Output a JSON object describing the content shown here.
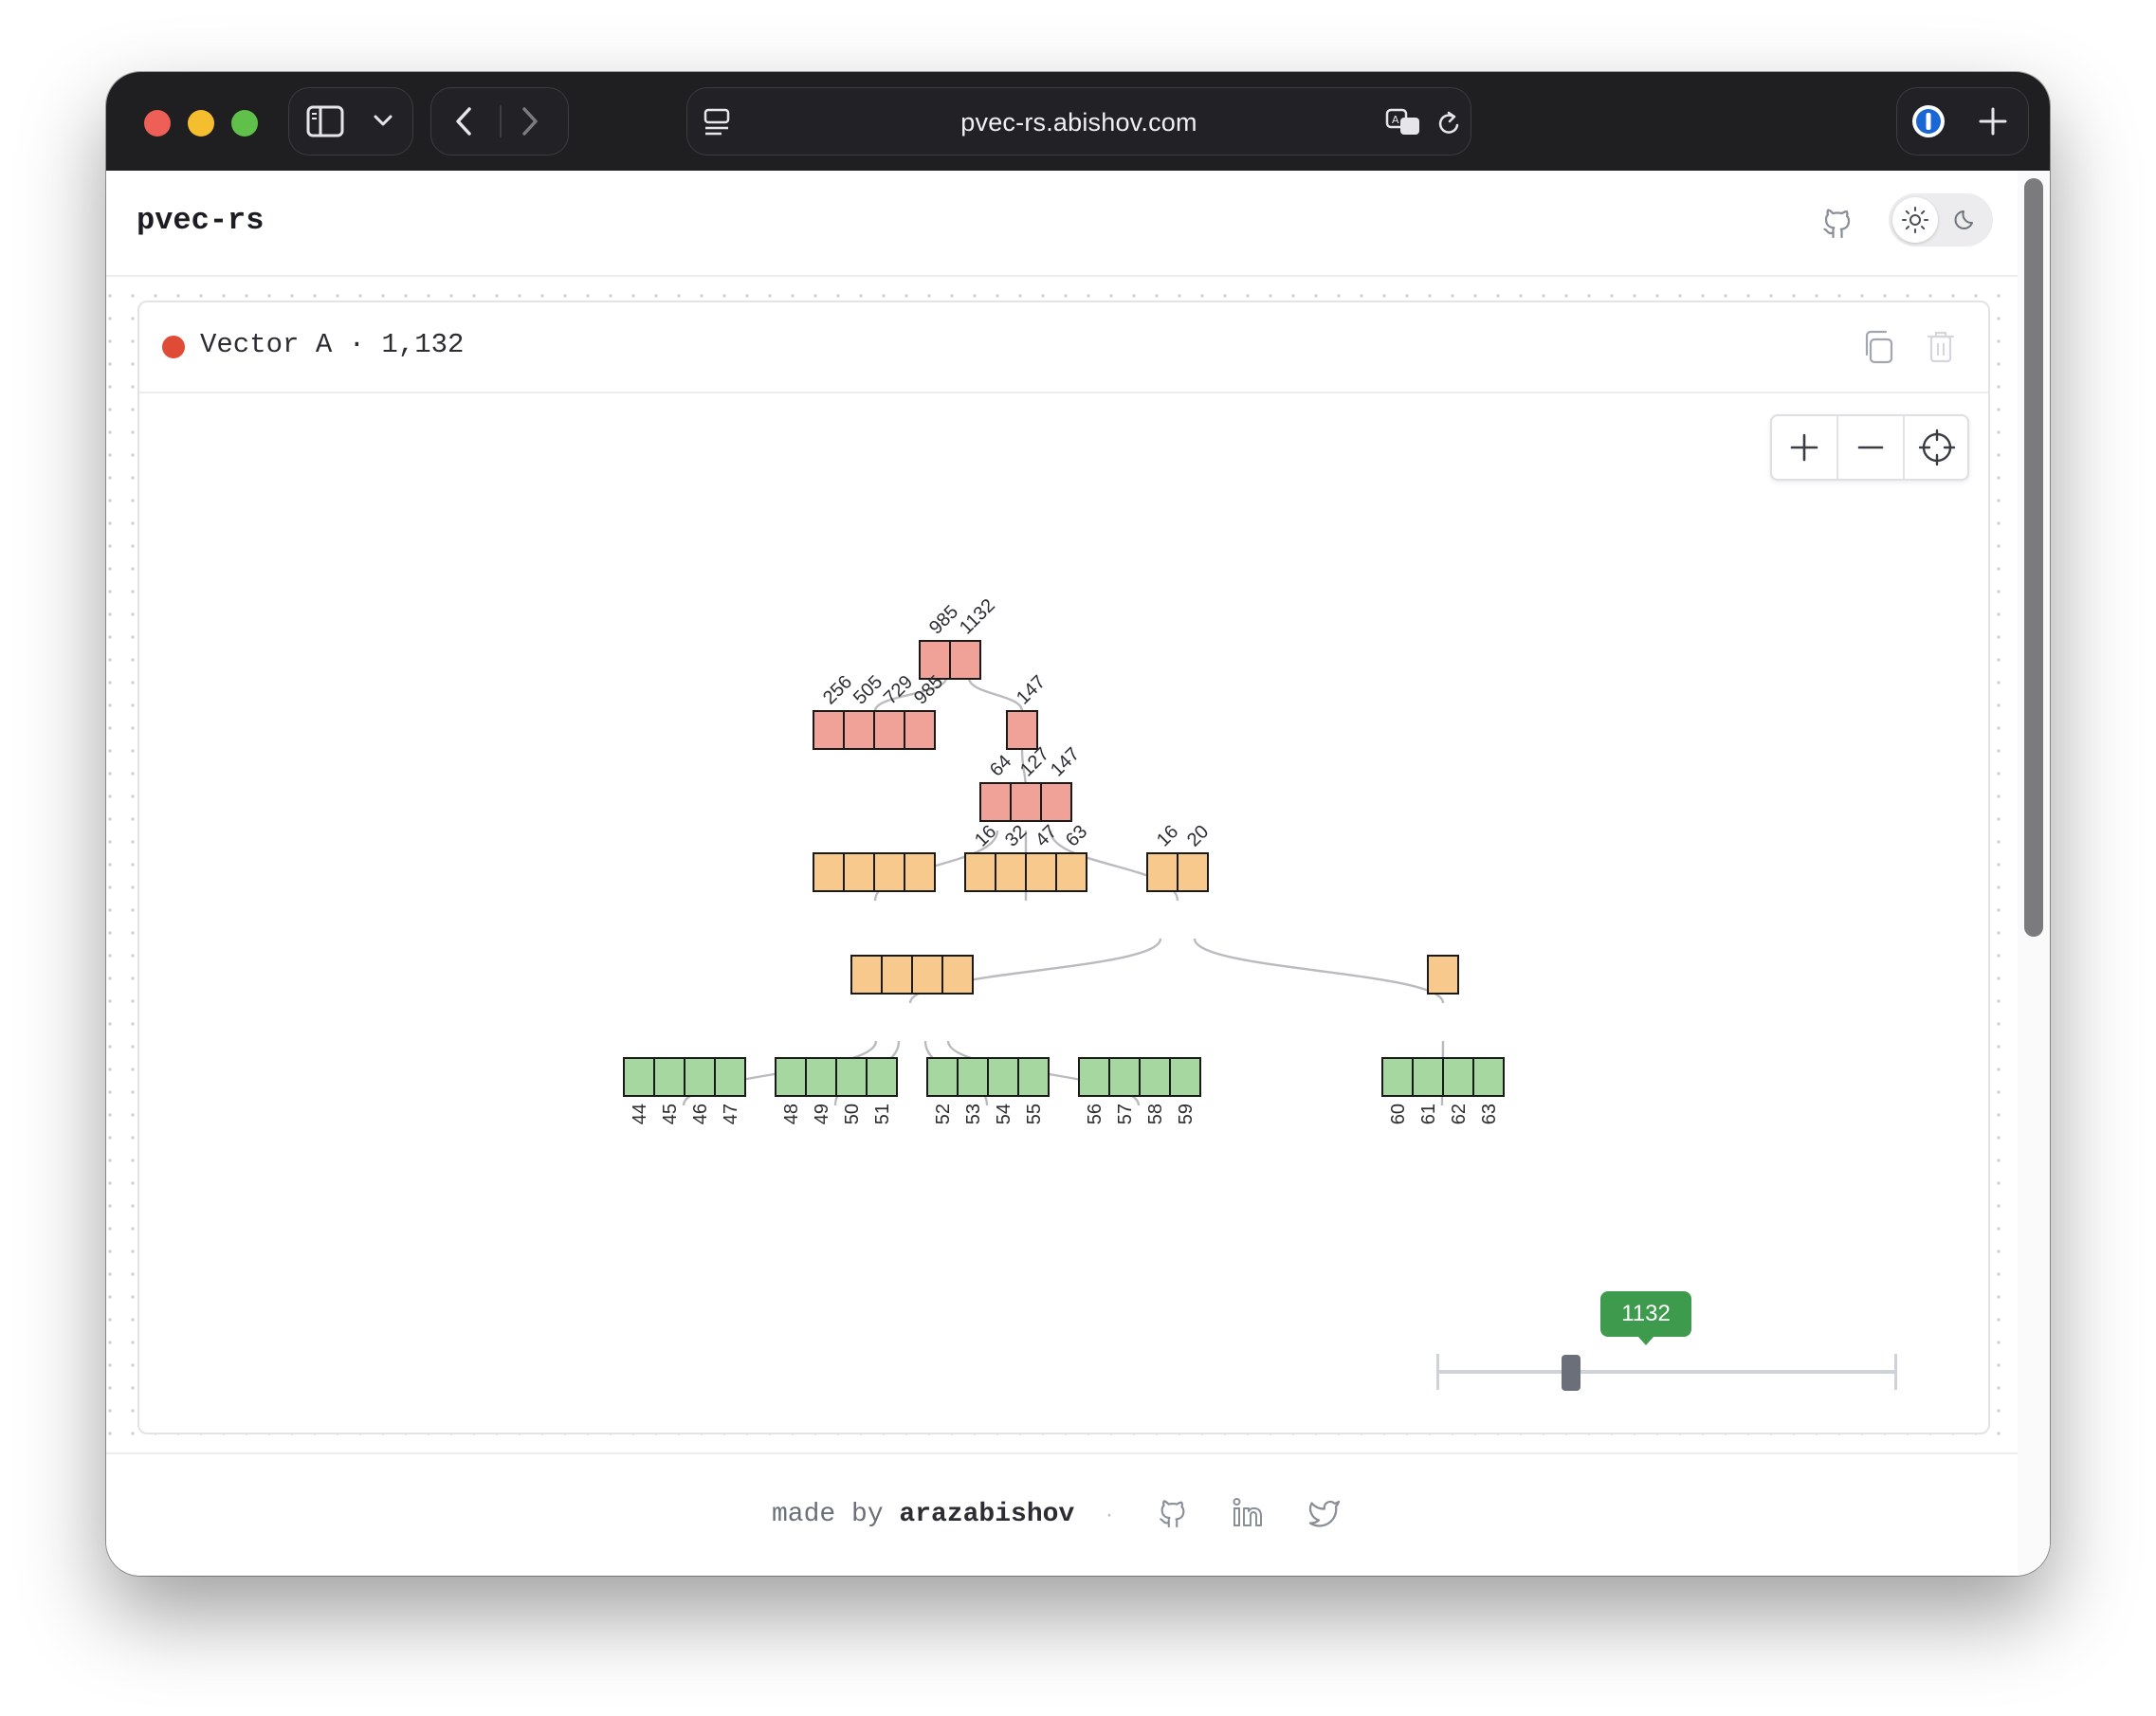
{
  "browser": {
    "url": "pvec-rs.abishov.com",
    "traffic_lights": [
      "#ed5f57",
      "#f5be2f",
      "#5fc04a"
    ]
  },
  "header": {
    "brand": "pvec-rs"
  },
  "vector": {
    "title": "Vector A · 1,132",
    "status_color": "#e04b35"
  },
  "zoom_controls": {
    "zoom_in": "+",
    "zoom_out": "−"
  },
  "tree": {
    "colors": {
      "branch_high": "#f0a298",
      "branch_low": "#f7c98d",
      "leaf": "#a7d7a0"
    },
    "root": {
      "labels": [
        "985",
        "1132"
      ]
    },
    "level2_left": {
      "labels": [
        "256",
        "505",
        "729",
        "985"
      ]
    },
    "level2_right": {
      "labels": [
        "147"
      ]
    },
    "level3": {
      "labels": [
        "64",
        "127",
        "147"
      ]
    },
    "level4_middle": {
      "labels": [
        "16",
        "32",
        "47",
        "63"
      ]
    },
    "level4_right": {
      "labels": [
        "16",
        "20"
      ]
    },
    "leaves": [
      [
        "44",
        "45",
        "46",
        "47"
      ],
      [
        "48",
        "49",
        "50",
        "51"
      ],
      [
        "52",
        "53",
        "54",
        "55"
      ],
      [
        "56",
        "57",
        "58",
        "59"
      ],
      [
        "60",
        "61",
        "62",
        "63"
      ]
    ]
  },
  "slider": {
    "value": "1132",
    "position_fraction": 0.28
  },
  "footer": {
    "made_by": "made by ",
    "author": "arazabishov",
    "separator": "·"
  }
}
